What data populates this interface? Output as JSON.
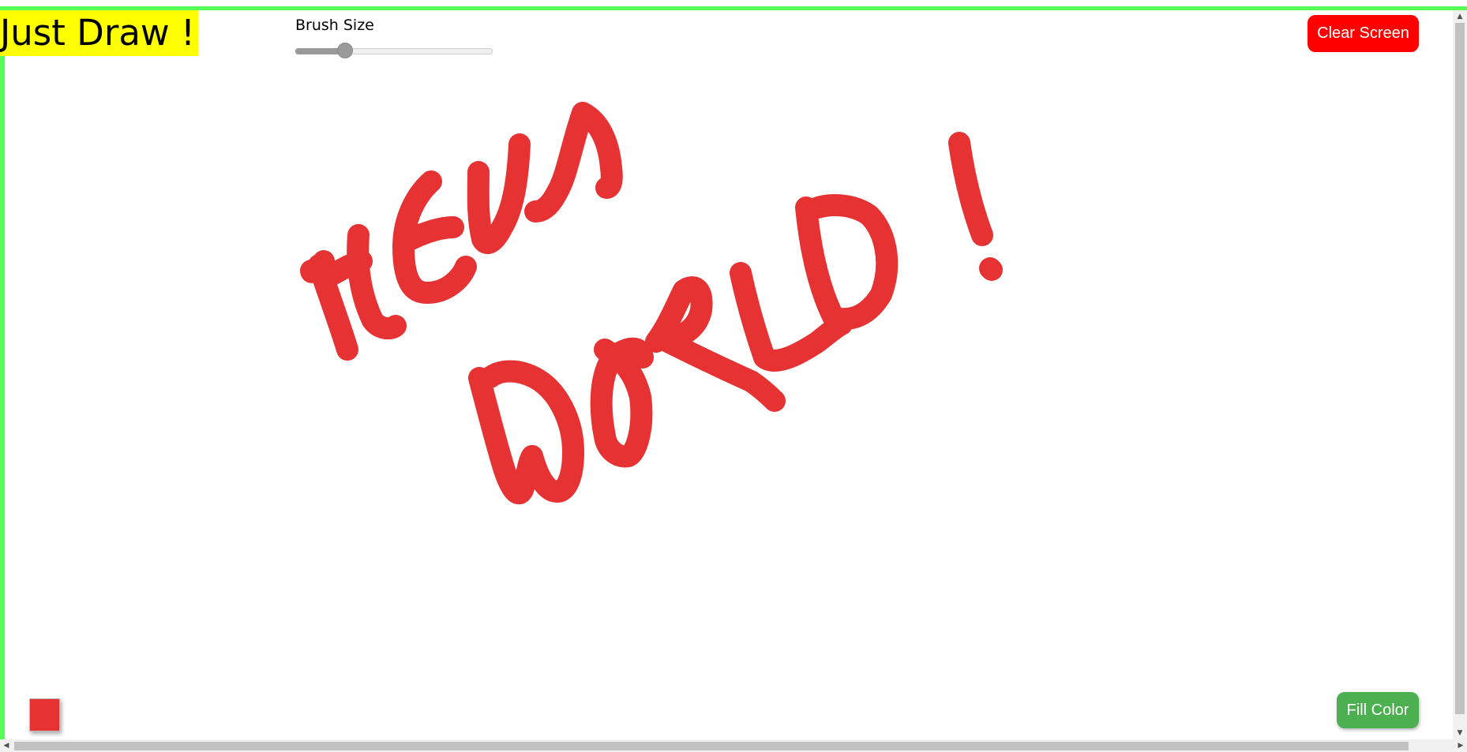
{
  "header": {
    "title": "Just Draw !",
    "brush_size_label": "Brush Size",
    "brush_size_value": 0.25,
    "clear_label": "Clear Screen"
  },
  "footer": {
    "fill_label": "Fill Color"
  },
  "colors": {
    "frame_green": "#55ff55",
    "title_highlight": "#ffff00",
    "clear_button": "#ff0000",
    "fill_button": "#4caf50",
    "brush_color": "#e63232"
  },
  "icons": {
    "scroll_up": "▲",
    "scroll_down": "▼",
    "scroll_left": "◀",
    "scroll_right": "▶"
  }
}
